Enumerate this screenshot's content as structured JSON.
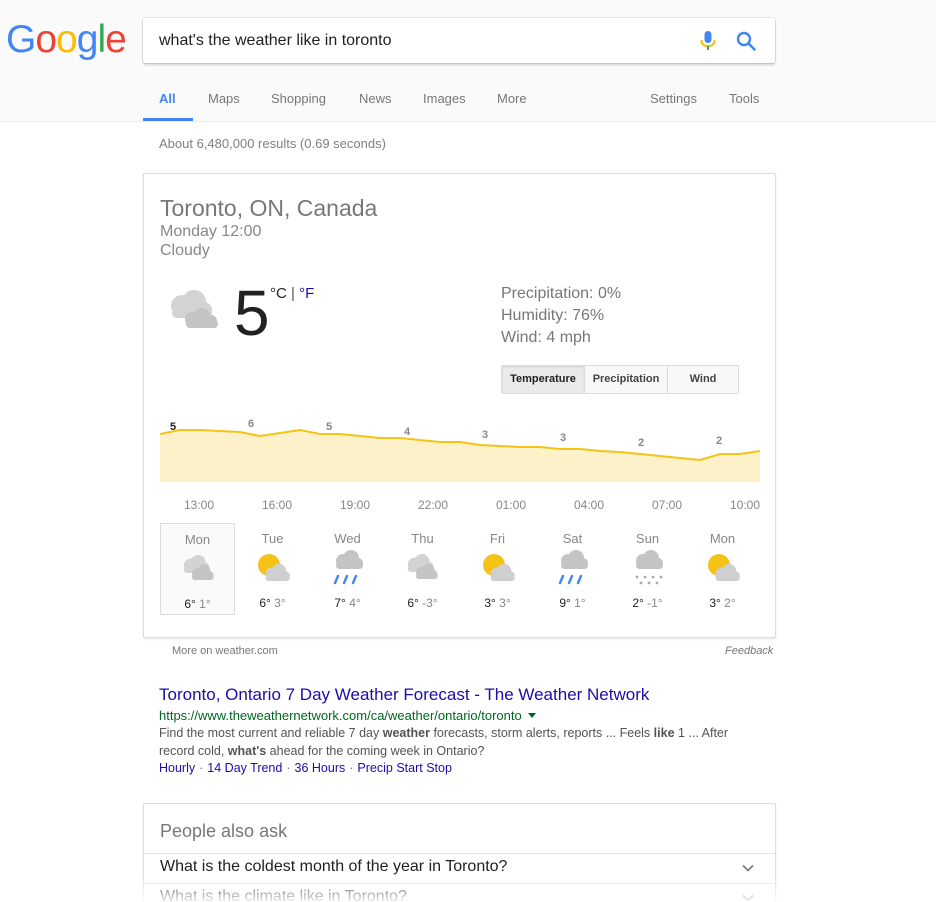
{
  "logo": {
    "text": "Google",
    "letters": [
      "G",
      "o",
      "o",
      "g",
      "l",
      "e"
    ],
    "colors": [
      "#4285f4",
      "#ea4335",
      "#fbbc05",
      "#4285f4",
      "#34a853",
      "#ea4335"
    ]
  },
  "search": {
    "query": "what's the weather like in toronto",
    "mic_icon": "mic-icon",
    "search_icon": "search-icon"
  },
  "tabs": [
    {
      "label": "All",
      "active": true
    },
    {
      "label": "Maps"
    },
    {
      "label": "Shopping"
    },
    {
      "label": "News"
    },
    {
      "label": "Images"
    },
    {
      "label": "More"
    },
    {
      "label": "Settings"
    },
    {
      "label": "Tools"
    }
  ],
  "result_stats": "About 6,480,000 results (0.69 seconds)",
  "weather": {
    "location": "Toronto, ON, Canada",
    "time": "Monday 12:00",
    "condition": "Cloudy",
    "current_icon": "cloudy-icon",
    "temperature": "5",
    "unit_c": "°C",
    "unit_sep": " | ",
    "unit_f": "°F",
    "precipitation": "Precipitation: 0%",
    "humidity": "Humidity: 76%",
    "wind": "Wind: 4 mph",
    "buttons": [
      "Temperature",
      "Precipitation",
      "Wind"
    ],
    "active_button": "Temperature",
    "chart_labels": [
      "5",
      "6",
      "5",
      "4",
      "3",
      "3",
      "2",
      "2"
    ],
    "hours": [
      "13:00",
      "16:00",
      "19:00",
      "22:00",
      "01:00",
      "04:00",
      "07:00",
      "10:00"
    ],
    "days": [
      {
        "name": "Mon",
        "icon": "cloudy-icon",
        "hi": "6°",
        "lo": "1°",
        "selected": true
      },
      {
        "name": "Tue",
        "icon": "partly-cloudy-icon",
        "hi": "6°",
        "lo": "3°"
      },
      {
        "name": "Wed",
        "icon": "rain-icon",
        "hi": "7°",
        "lo": "4°"
      },
      {
        "name": "Thu",
        "icon": "cloudy-icon",
        "hi": "6°",
        "lo": "-3°"
      },
      {
        "name": "Fri",
        "icon": "partly-cloudy-icon",
        "hi": "3°",
        "lo": "3°"
      },
      {
        "name": "Sat",
        "icon": "rain-icon",
        "hi": "9°",
        "lo": "1°"
      },
      {
        "name": "Sun",
        "icon": "snow-icon",
        "hi": "2°",
        "lo": "-1°"
      },
      {
        "name": "Mon",
        "icon": "partly-cloudy-icon",
        "hi": "3°",
        "lo": "2°"
      }
    ],
    "more_link": "More on weather.com",
    "feedback": "Feedback",
    "colors": {
      "line": "#f5c316",
      "fill": "#fdf1c9",
      "sun": "#f5c316",
      "cloud": "#cfcfcf",
      "rain": "#4285f4"
    }
  },
  "result": {
    "title": "Toronto, Ontario 7 Day Weather Forecast - The Weather Network",
    "url": "https://www.theweathernetwork.com/ca/weather/ontario/toronto",
    "snippet_parts": [
      {
        "t": "Find the most current and reliable 7 day ",
        "b": false
      },
      {
        "t": "weather",
        "b": true
      },
      {
        "t": " forecasts, storm alerts, reports ... Feels ",
        "b": false
      },
      {
        "t": "like",
        "b": true
      },
      {
        "t": " 1 ... After record cold, ",
        "b": false
      },
      {
        "t": "what's",
        "b": true
      },
      {
        "t": " ahead for the coming week in Ontario?",
        "b": false
      }
    ],
    "sitelinks": [
      "Hourly",
      "14 Day Trend",
      "36 Hours",
      "Precip Start Stop"
    ],
    "sitelink_sep": "·"
  },
  "people_also_ask": {
    "title": "People also ask",
    "questions": [
      "What is the coldest month of the year in Toronto?",
      "What is the climate like in Toronto?"
    ]
  }
}
